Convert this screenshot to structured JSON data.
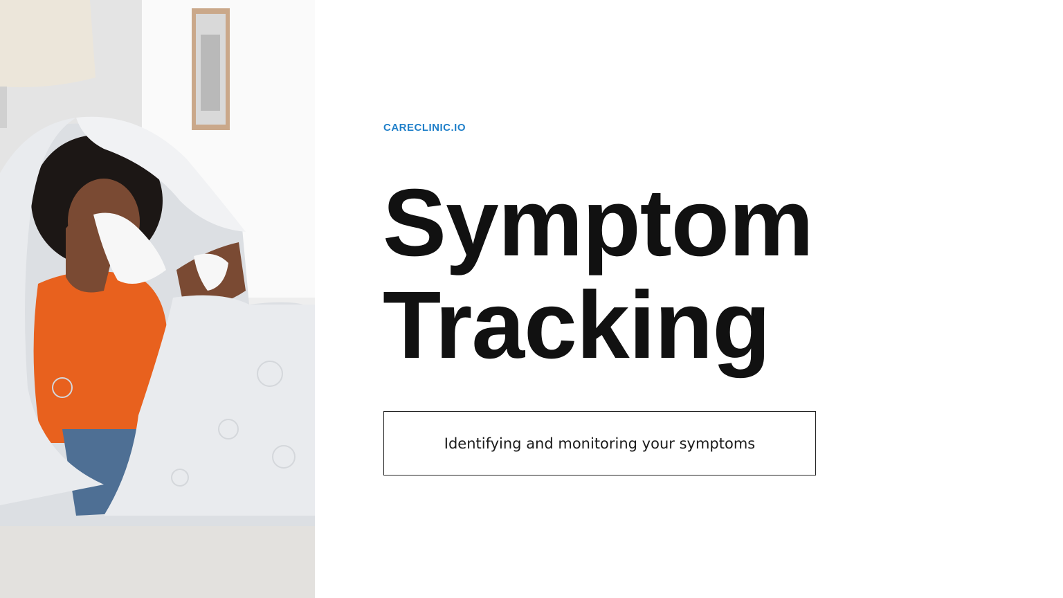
{
  "brand": "CARECLINIC.IO",
  "title_line_1": "Symptom",
  "title_line_2": "Tracking",
  "subtitle": "Identifying and monitoring your symptoms",
  "photo": {
    "subject": "person-wrapped-in-blanket-blowing-nose-icon"
  },
  "colors": {
    "brand": "#1f7fc9",
    "title": "#111111",
    "background": "#ffffff",
    "shirt": "#e8611e",
    "blanket": "#e9ebee"
  }
}
